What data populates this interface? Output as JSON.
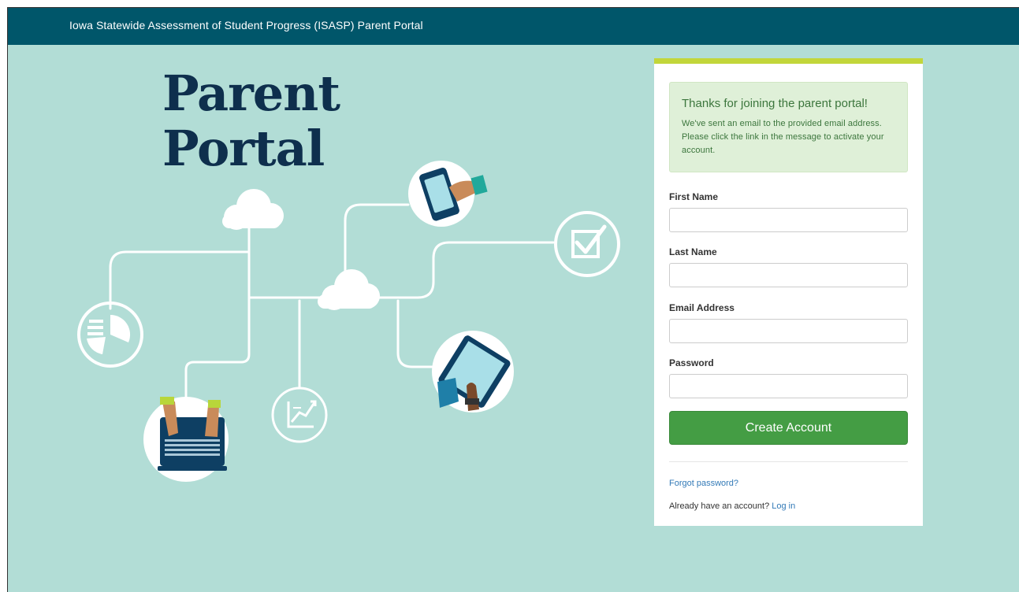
{
  "header": {
    "title": "Iowa Statewide Assessment of Student Progress (ISASP) Parent Portal"
  },
  "hero": {
    "line1": "Parent",
    "line2": "Portal"
  },
  "colors": {
    "header_bg": "#00566a",
    "page_bg": "#b2ddd6",
    "hero_text": "#0e2f4d",
    "accent_bar": "#c2d63a",
    "alert_bg": "#dff0d8",
    "button_bg": "#449d44",
    "link": "#337ab7"
  },
  "icons": [
    "cloud-icon",
    "pie-chart-icon",
    "smartphone-icon",
    "checkbox-icon",
    "growth-chart-icon",
    "tablet-icon",
    "laptop-icon"
  ],
  "alert": {
    "heading": "Thanks for joining the parent portal!",
    "message": "We've sent an email to the provided email address. Please click the link in the message to activate your account."
  },
  "form": {
    "first_name": {
      "label": "First Name",
      "value": ""
    },
    "last_name": {
      "label": "Last Name",
      "value": ""
    },
    "email": {
      "label": "Email Address",
      "value": ""
    },
    "password": {
      "label": "Password",
      "value": ""
    },
    "submit_label": "Create Account"
  },
  "links": {
    "forgot_password": "Forgot password?",
    "already_text": "Already have an account?",
    "login": "Log in"
  }
}
